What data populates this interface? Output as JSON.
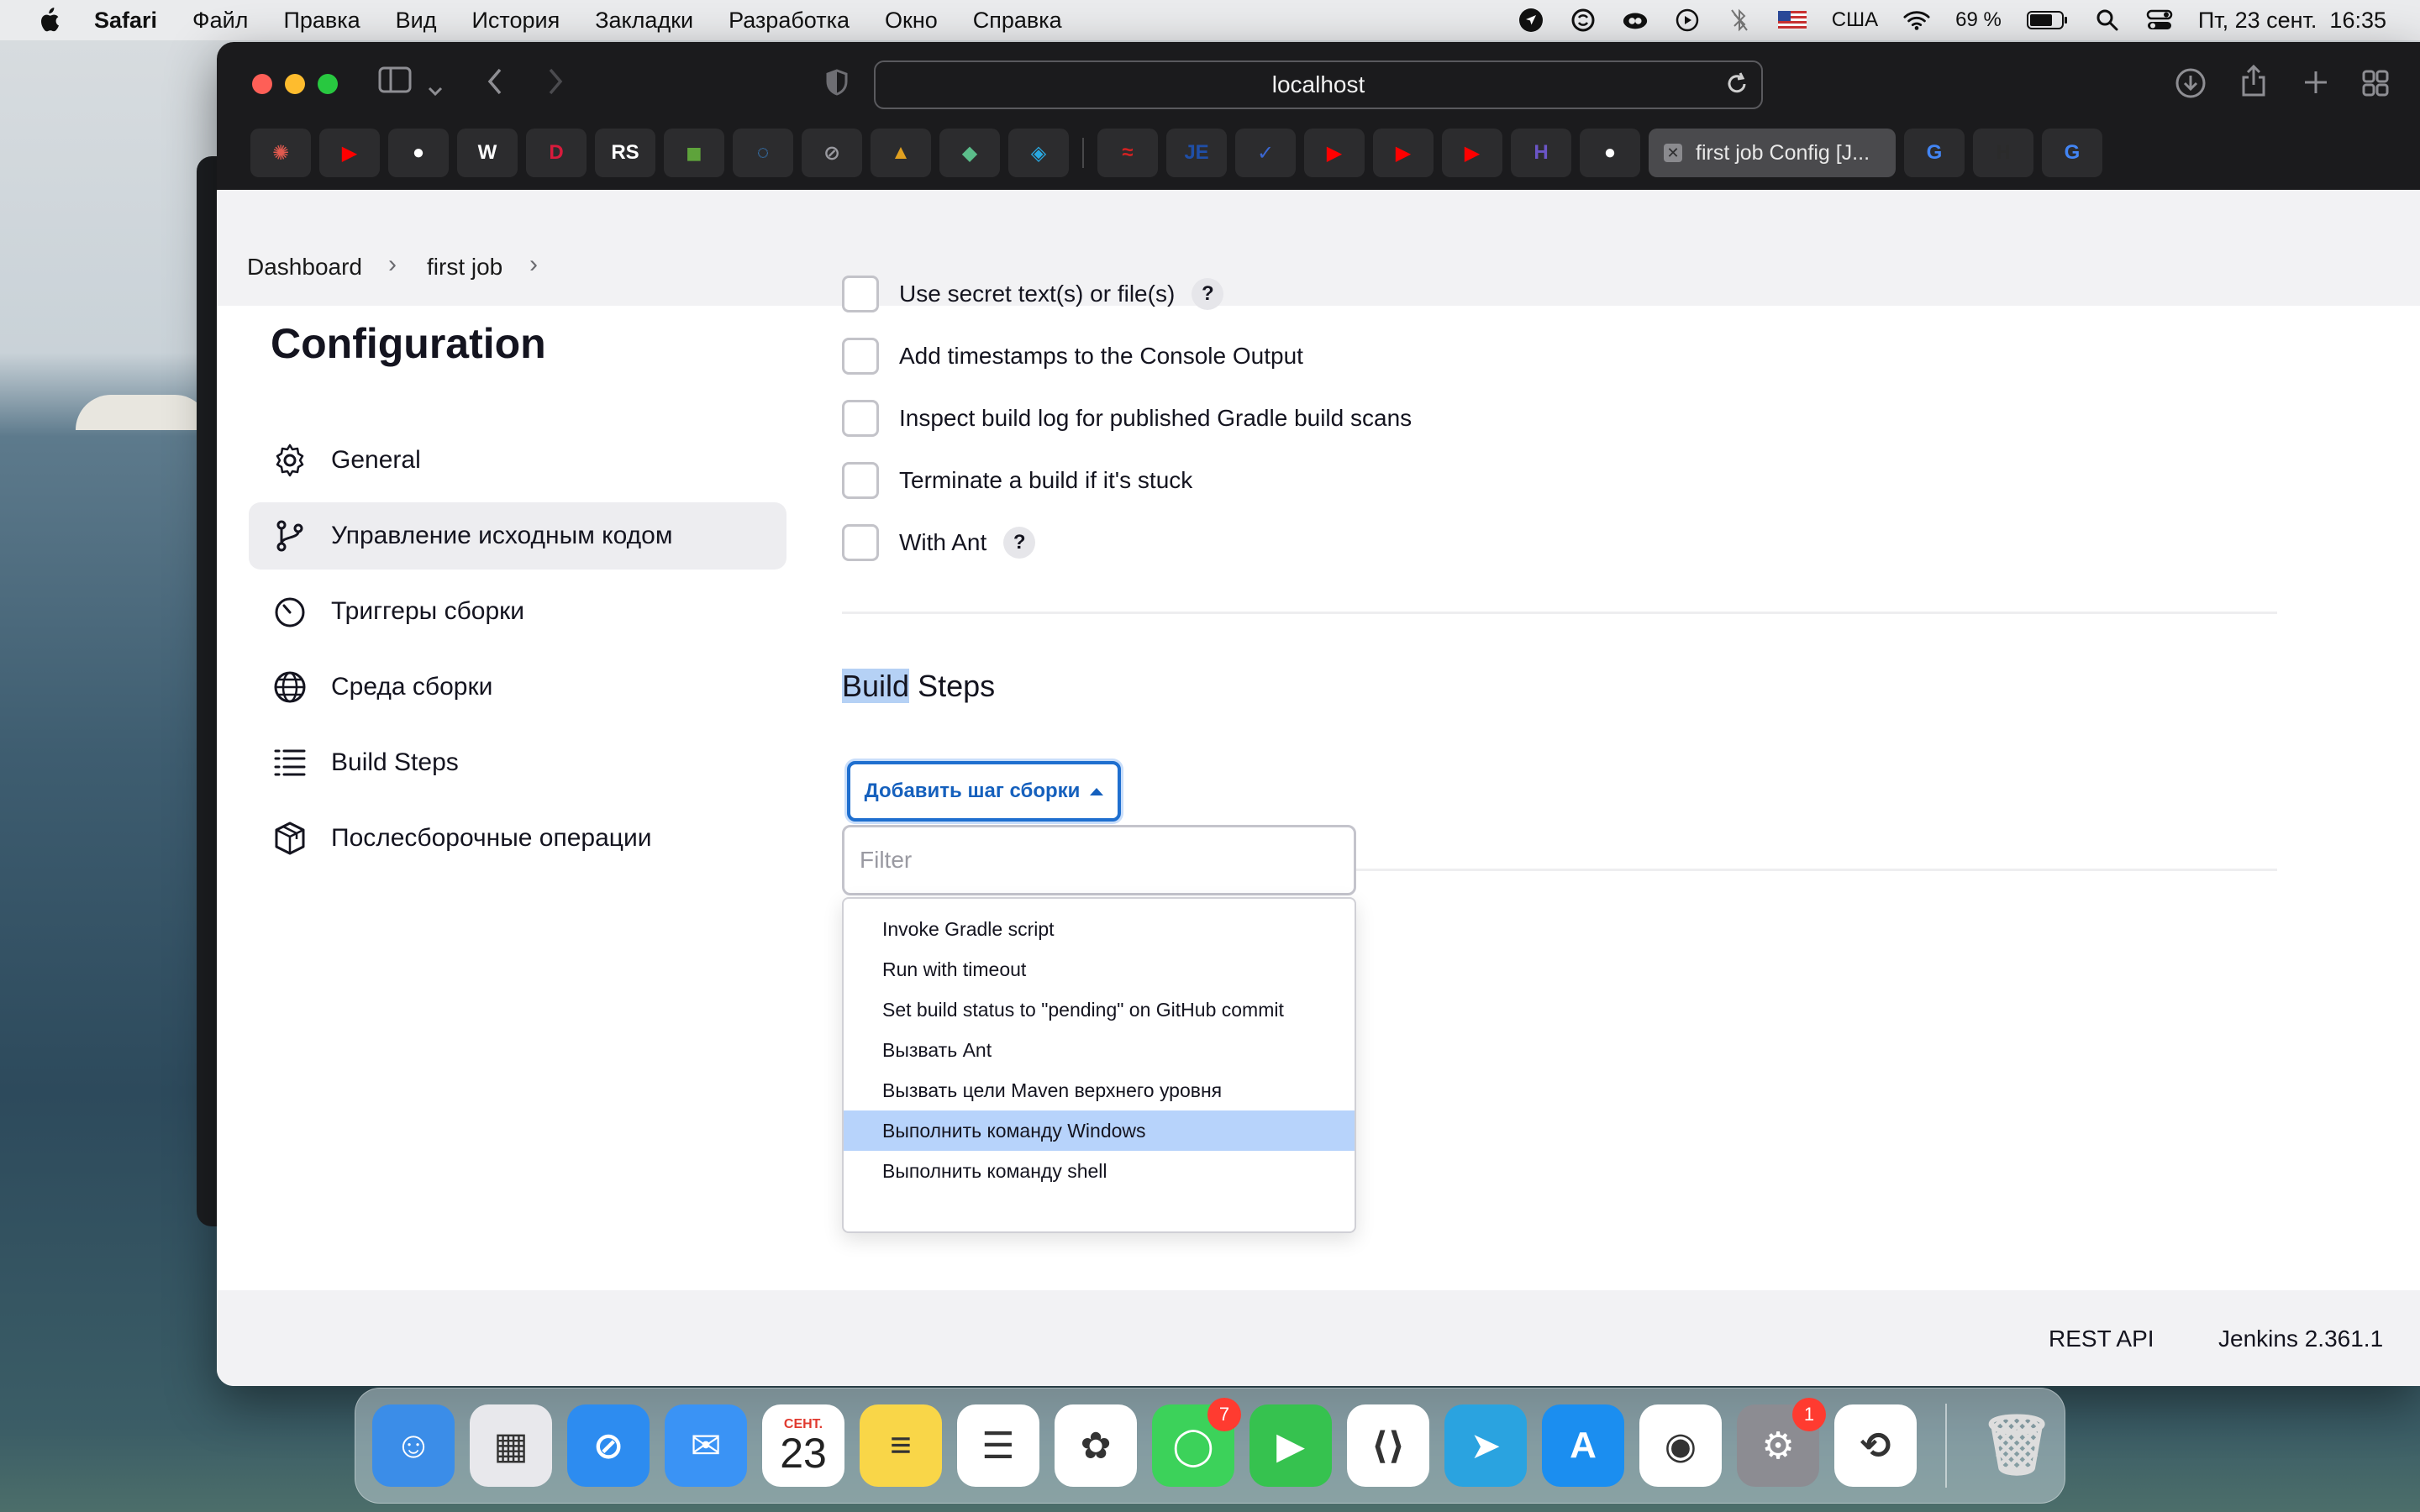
{
  "menubar": {
    "app_name": "Safari",
    "items": [
      "Файл",
      "Правка",
      "Вид",
      "История",
      "Закладки",
      "Разработка",
      "Окно",
      "Справка"
    ],
    "keyboard_layout": "США",
    "battery": "69 %",
    "datetime": "Пт, 23 сент.  16:35"
  },
  "browser": {
    "url": "localhost",
    "active_tab_title": "first job Config [J...",
    "favicons": [
      {
        "name": "chatgpt-icon",
        "glyph": "✺",
        "color": "#e05a4f"
      },
      {
        "name": "youtube-icon",
        "glyph": "▶",
        "color": "#ff0000"
      },
      {
        "name": "github-icon",
        "glyph": "●",
        "color": "#ffffff"
      },
      {
        "name": "wikipedia-icon",
        "glyph": "W",
        "color": "#ffffff"
      },
      {
        "name": "d-icon",
        "glyph": "D",
        "color": "#d81b3c"
      },
      {
        "name": "rs-icon",
        "glyph": "RS",
        "color": "#ffffff"
      },
      {
        "name": "car-icon",
        "glyph": "◼",
        "color": "#5ea33b"
      },
      {
        "name": "loader-icon",
        "glyph": "◌",
        "color": "#3a8fe0"
      },
      {
        "name": "compass-icon",
        "glyph": "⊘",
        "color": "#9a9aa0"
      },
      {
        "name": "triangle-icon",
        "glyph": "▲",
        "color": "#e0a020"
      },
      {
        "name": "diamond-icon",
        "glyph": "◆",
        "color": "#5bbd8a"
      },
      {
        "name": "frame-icon",
        "glyph": "◈",
        "color": "#29a8e0"
      }
    ],
    "favicons_after": [
      {
        "name": "red-logo-icon",
        "glyph": "≈",
        "color": "#d42222"
      },
      {
        "name": "je-icon",
        "glyph": "JE",
        "color": "#1f4fa8"
      },
      {
        "name": "check-icon",
        "glyph": "✓",
        "color": "#3a66d1"
      },
      {
        "name": "youtube-icon",
        "glyph": "▶",
        "color": "#ff0000"
      },
      {
        "name": "youtube-icon",
        "glyph": "▶",
        "color": "#ff0000"
      },
      {
        "name": "youtube-icon",
        "glyph": "▶",
        "color": "#ff0000"
      },
      {
        "name": "h-logo-icon",
        "glyph": "H",
        "color": "#6b55c7"
      },
      {
        "name": "github-icon",
        "glyph": "●",
        "color": "#ffffff"
      }
    ],
    "favicons_tail": [
      {
        "name": "google-icon",
        "glyph": "G",
        "color": "#4285f4"
      },
      {
        "name": "hexlet-icon",
        "glyph": "H",
        "color": "#2b2b2b"
      },
      {
        "name": "google-icon",
        "glyph": "G",
        "color": "#4285f4"
      }
    ]
  },
  "breadcrumb": {
    "items": [
      "Dashboard",
      "first job"
    ]
  },
  "sidebar": {
    "title": "Configuration",
    "items": [
      {
        "label": "General",
        "icon": "gear-icon"
      },
      {
        "label": "Управление исходным кодом",
        "icon": "branch-icon",
        "active": true
      },
      {
        "label": "Триггеры сборки",
        "icon": "timer-icon"
      },
      {
        "label": "Среда сборки",
        "icon": "globe-icon"
      },
      {
        "label": "Build Steps",
        "icon": "list-icon"
      },
      {
        "label": "Послесборочные операции",
        "icon": "package-icon"
      }
    ]
  },
  "build_env": {
    "checkboxes": [
      {
        "label": "Use secret text(s) or file(s)",
        "help": "?"
      },
      {
        "label": "Add timestamps to the Console Output"
      },
      {
        "label": "Inspect build log for published Gradle build scans"
      },
      {
        "label": "Terminate a build if it's stuck"
      },
      {
        "label": "With Ant",
        "help": "?"
      }
    ]
  },
  "build_steps": {
    "title_highlight": "Build",
    "title_rest": " Steps",
    "add_button": "Добавить шаг сборки",
    "filter_placeholder": "Filter",
    "options": [
      "Invoke Gradle script",
      "Run with timeout",
      "Set build status to \"pending\" on GitHub commit",
      "Вызвать Ant",
      "Вызвать цели Maven верхнего уровня",
      "Выполнить команду Windows",
      "Выполнить команду shell"
    ],
    "selected_option": "Выполнить команду Windows"
  },
  "footer": {
    "rest_api": "REST API",
    "version": "Jenkins 2.361.1"
  },
  "dock": {
    "apps": [
      {
        "name": "finder-icon",
        "bg": "#3b8de8",
        "glyph": "☺"
      },
      {
        "name": "launchpad-icon",
        "bg": "#e8e8ec",
        "glyph": "▦"
      },
      {
        "name": "safari-icon",
        "bg": "#2d8cf0",
        "glyph": "⊘"
      },
      {
        "name": "mail-icon",
        "bg": "#3a93f5",
        "glyph": "✉"
      },
      {
        "name": "calendar-icon",
        "bg": "#ffffff",
        "glyph": "23",
        "month": "СЕНТ."
      },
      {
        "name": "notes-icon",
        "bg": "#f9d648",
        "glyph": "≡"
      },
      {
        "name": "reminders-icon",
        "bg": "#ffffff",
        "glyph": "☰"
      },
      {
        "name": "photos-icon",
        "bg": "#ffffff",
        "glyph": "✿"
      },
      {
        "name": "messages-icon",
        "bg": "#3cd25a",
        "glyph": "◯",
        "badge": "7"
      },
      {
        "name": "facetime-icon",
        "bg": "#36c24f",
        "glyph": "▶"
      },
      {
        "name": "vscode-icon",
        "bg": "#ffffff",
        "glyph": "⟨⟩"
      },
      {
        "name": "telegram-icon",
        "bg": "#2aa3e0",
        "glyph": "➤"
      },
      {
        "name": "appstore-icon",
        "bg": "#1b8ef0",
        "glyph": "A"
      },
      {
        "name": "chrome-icon",
        "bg": "#ffffff",
        "glyph": "◉"
      },
      {
        "name": "system-settings-icon",
        "bg": "#8c8c92",
        "glyph": "⚙",
        "badge": "1"
      },
      {
        "name": "sync-icon",
        "bg": "#ffffff",
        "glyph": "⟲"
      }
    ],
    "trash": {
      "name": "trash-icon",
      "glyph": "🗑"
    }
  },
  "colors": {
    "accent": "#1f6fcf",
    "selected_option": "#b7d3fb",
    "sidebar_active": "#ededf0"
  }
}
